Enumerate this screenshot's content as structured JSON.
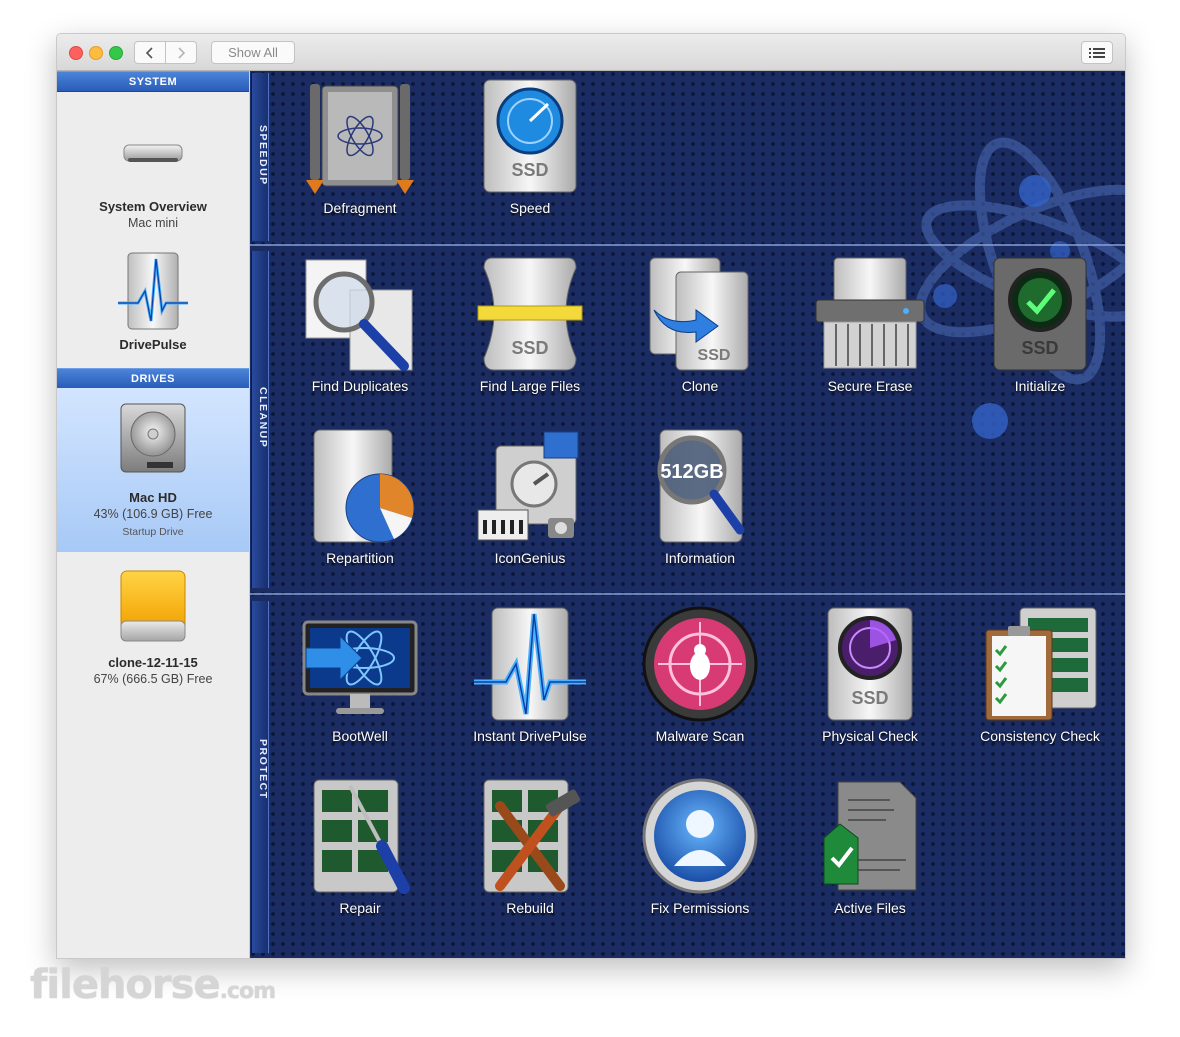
{
  "toolbar": {
    "back_icon": "chevron-left-icon",
    "forward_icon": "chevron-right-icon",
    "show_all_label": "Show All",
    "list_icon": "list-view-icon"
  },
  "sidebar": {
    "system_header": "SYSTEM",
    "drives_header": "DRIVES",
    "system_items": [
      {
        "title": "System Overview",
        "subtitle": "Mac mini",
        "icon": "mac-mini-icon"
      },
      {
        "title": "DrivePulse",
        "icon": "drivepulse-icon"
      }
    ],
    "drive_items": [
      {
        "title": "Mac HD",
        "subtitle": "43% (106.9 GB) Free",
        "note": "Startup Drive",
        "icon": "hard-drive-icon",
        "selected": true
      },
      {
        "title": "clone-12-11-15",
        "subtitle": "67% (666.5 GB) Free",
        "icon": "external-drive-icon"
      }
    ]
  },
  "sections": {
    "speedup": "SPEEDUP",
    "cleanup": "CLEANUP",
    "protect": "PROTECT"
  },
  "tools": {
    "defragment": "Defragment",
    "speed": "Speed",
    "find_duplicates": "Find Duplicates",
    "find_large_files": "Find Large Files",
    "clone": "Clone",
    "secure_erase": "Secure Erase",
    "initialize": "Initialize",
    "repartition": "Repartition",
    "icongenius": "IconGenius",
    "information": "Information",
    "bootwell": "BootWell",
    "instant_drivepulse": "Instant DrivePulse",
    "malware_scan": "Malware Scan",
    "physical_check": "Physical Check",
    "consistency_check": "Consistency Check",
    "repair": "Repair",
    "rebuild": "Rebuild",
    "fix_permissions": "Fix Permissions",
    "active_files": "Active Files"
  },
  "icon_text": {
    "ssd": "SSD",
    "size": "512GB"
  },
  "watermark": {
    "main": "filehorse",
    "suffix": ".com"
  },
  "colors": {
    "content_bg": "#1b2c63",
    "sidebar_header": "#2a5cb8",
    "selected_row": "#a7c9f6",
    "label_text": "#ffffff"
  }
}
